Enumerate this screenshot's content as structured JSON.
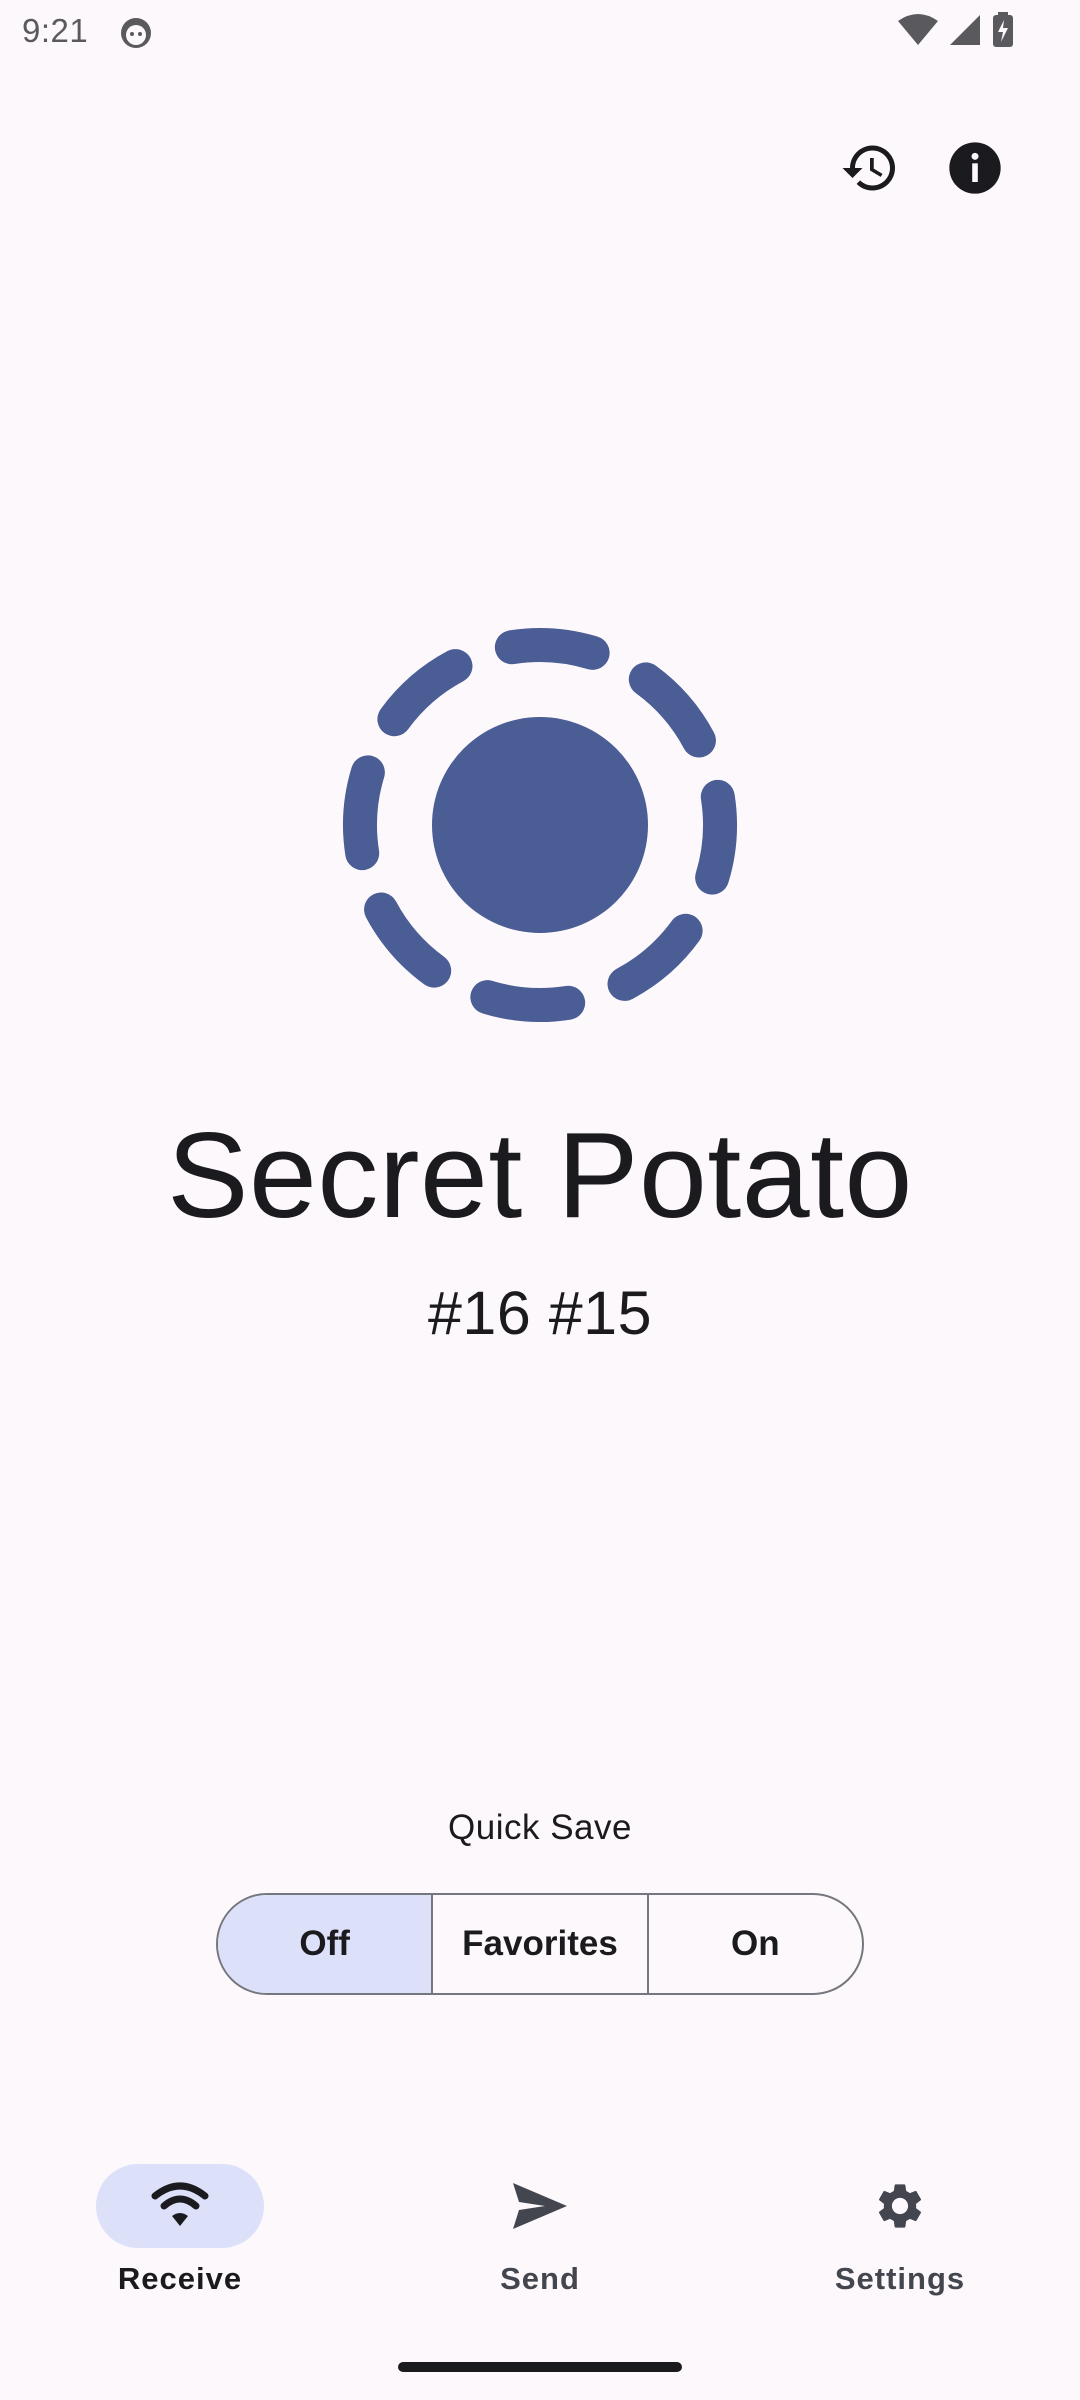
{
  "status_bar": {
    "time": "9:21",
    "icons": [
      "cat-face-icon",
      "wifi-icon",
      "signal-icon",
      "battery-charging-icon"
    ]
  },
  "top_actions": {
    "history_icon": "history-icon",
    "info_icon": "info-icon"
  },
  "device": {
    "name": "Secret Potato",
    "tags": "#16 #15",
    "logo_color": "#4a5d94"
  },
  "quick_save": {
    "label": "Quick Save",
    "options": [
      "Off",
      "Favorites",
      "On"
    ],
    "selected": "Off"
  },
  "bottom_nav": {
    "items": [
      {
        "label": "Receive",
        "icon": "wifi-icon",
        "active": true
      },
      {
        "label": "Send",
        "icon": "send-icon",
        "active": false
      },
      {
        "label": "Settings",
        "icon": "gear-icon",
        "active": false
      }
    ]
  },
  "colors": {
    "background": "#fdf8fc",
    "accent": "#4a5d94",
    "selected_container": "#dce1f9",
    "outline": "#75777f"
  }
}
